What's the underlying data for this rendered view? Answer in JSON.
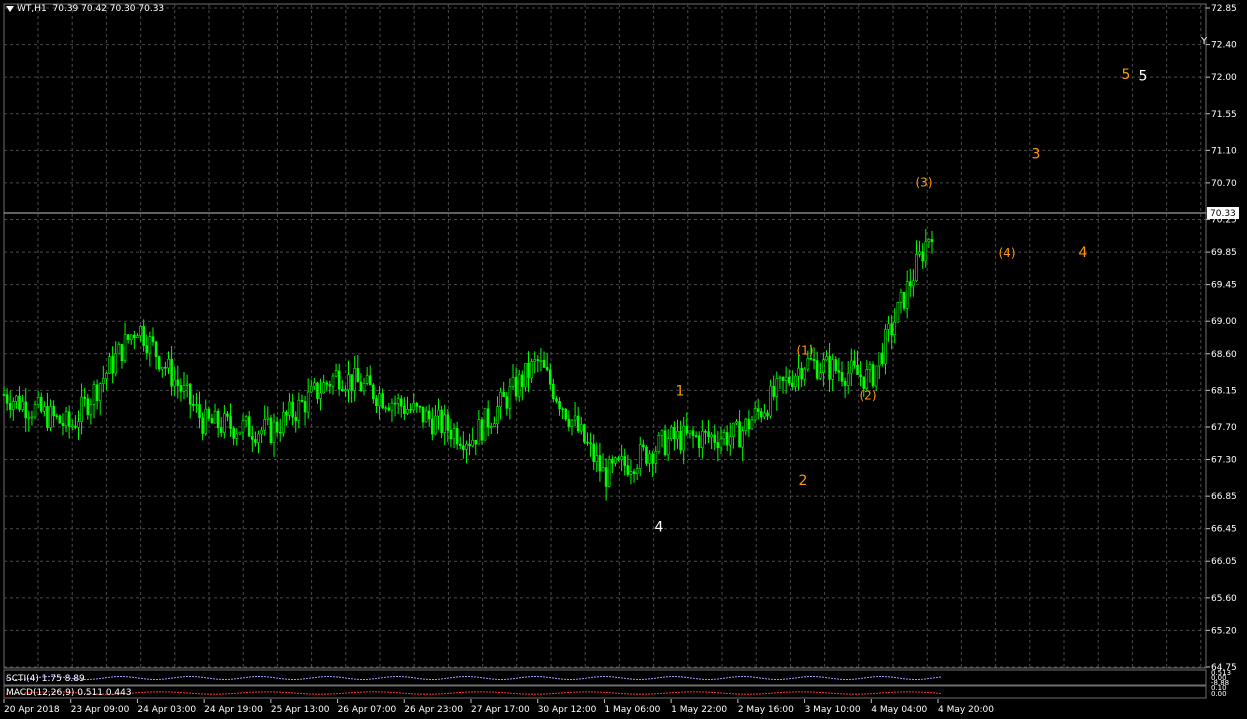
{
  "header": {
    "symbol": "WT,H1",
    "ohlc": "70.39 70.42 70.30 70.33"
  },
  "price_axis": {
    "ticks": [
      "72.85",
      "72.40",
      "72.00",
      "71.55",
      "71.10",
      "70.70",
      "70.25",
      "69.85",
      "69.45",
      "69.00",
      "68.60",
      "68.15",
      "67.70",
      "67.30",
      "66.85",
      "66.45",
      "66.05",
      "65.60",
      "65.20",
      "64.75"
    ],
    "current_price": "70.33"
  },
  "time_axis": {
    "labels": [
      "20 Apr 2018",
      "23 Apr 09:00",
      "24 Apr 03:00",
      "24 Apr 19:00",
      "25 Apr 13:00",
      "26 Apr 07:00",
      "26 Apr 23:00",
      "27 Apr 17:00",
      "30 Apr 12:00",
      "1 May 06:00",
      "1 May 22:00",
      "2 May 16:00",
      "3 May 10:00",
      "4 May 04:00",
      "4 May 20:00"
    ]
  },
  "indicators": {
    "ind1": {
      "label": "SCTI(4) 1.75 8.89"
    },
    "ind2": {
      "label": "MACD(12,26,9) 0.511 0.443"
    },
    "ind1_axis": [
      "0.513",
      "0.00",
      "-8.88"
    ],
    "ind2_axis": [
      "0.10",
      "0.00"
    ]
  },
  "wave_labels": [
    {
      "text": "1",
      "color": "#ff9900",
      "date": "1 May 22:00",
      "price": 68.15
    },
    {
      "text": "2",
      "color": "#ff9900",
      "date": "3 May 10:00",
      "price": 67.05
    },
    {
      "text": "(1)",
      "color": "#ff9900",
      "date": "3 May 10:00",
      "price": 68.65
    },
    {
      "text": "(2)",
      "color": "#ff9900",
      "date": "4 May 04:00",
      "price": 68.1
    },
    {
      "text": "(3)",
      "color": "#ff9900",
      "date": "4 May 20:00",
      "price": 70.72
    },
    {
      "text": "(4)",
      "color": "#ff9900",
      "date": "",
      "price": 69.85
    },
    {
      "text": "3",
      "color": "#ff9900",
      "date": "",
      "price": 71.06
    },
    {
      "text": "4",
      "color": "#ff9900",
      "date": "",
      "price": 69.85
    },
    {
      "text": "5",
      "color": "#ff9900",
      "date": "",
      "price": 72.04
    },
    {
      "text": "5",
      "color": "#ffffff",
      "date": "",
      "price": 72.02
    },
    {
      "text": "4",
      "color": "#ffffff",
      "date": "1 May 06:00",
      "price": 66.48
    }
  ],
  "chart_data": {
    "type": "candlestick",
    "title": "WT,H1",
    "ylim": [
      64.5,
      72.95
    ],
    "grid": true,
    "legend": "none",
    "close_path": [
      {
        "x": "20 Apr 2018",
        "y": 68.1
      },
      {
        "x": "23 Apr 09:00",
        "y": 67.7
      },
      {
        "x": "24 Apr 03:00",
        "y": 68.95
      },
      {
        "x": "24 Apr 19:00",
        "y": 67.75
      },
      {
        "x": "25 Apr 13:00",
        "y": 67.65
      },
      {
        "x": "26 Apr 07:00",
        "y": 68.35
      },
      {
        "x": "26 Apr 23:00",
        "y": 67.95
      },
      {
        "x": "27 Apr 17:00",
        "y": 67.55
      },
      {
        "x": "30 Apr 12:00",
        "y": 68.5
      },
      {
        "x": "1 May 06:00",
        "y": 67.1
      },
      {
        "x": "1 May 22:00",
        "y": 67.55
      },
      {
        "x": "2 May 16:00",
        "y": 67.6
      },
      {
        "x": "3 May 10:00",
        "y": 68.5
      },
      {
        "x": "4 May 04:00",
        "y": 68.3
      },
      {
        "x": "4 May 20:00",
        "y": 70.33
      }
    ],
    "colors": {
      "up": "#00ff00",
      "down": "#00ff00",
      "grid": "#4a4a4a",
      "current_line": "#bfbfbf"
    }
  }
}
